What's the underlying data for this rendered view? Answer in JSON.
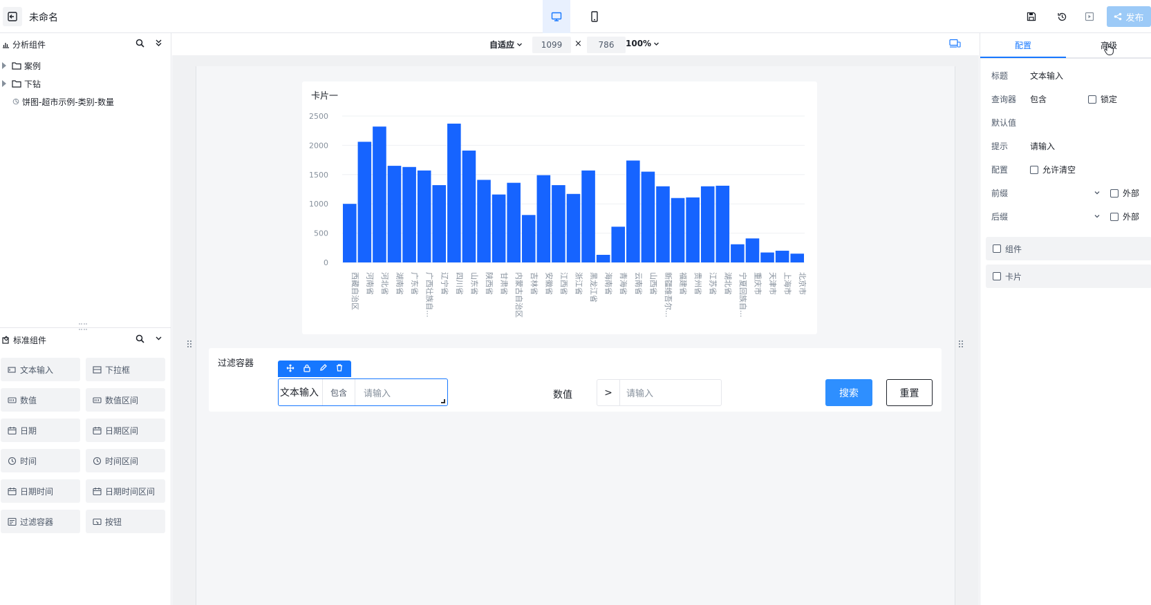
{
  "header": {
    "title": "未命名",
    "publish_label": "发布"
  },
  "left": {
    "analysis_title": "分析组件",
    "tree": [
      {
        "label": "案例",
        "type": "folder"
      },
      {
        "label": "下钻",
        "type": "folder"
      },
      {
        "label": "饼图-超市示例-类别-数量",
        "type": "chart"
      }
    ],
    "standard_title": "标准组件",
    "components": [
      {
        "label": "文本输入",
        "icon": "text-input-icon"
      },
      {
        "label": "下拉框",
        "icon": "select-icon"
      },
      {
        "label": "数值",
        "icon": "number-icon"
      },
      {
        "label": "数值区间",
        "icon": "number-range-icon"
      },
      {
        "label": "日期",
        "icon": "calendar-icon"
      },
      {
        "label": "日期区间",
        "icon": "calendar-icon"
      },
      {
        "label": "时间",
        "icon": "clock-icon"
      },
      {
        "label": "时间区间",
        "icon": "clock-icon"
      },
      {
        "label": "日期时间",
        "icon": "calendar-icon"
      },
      {
        "label": "日期时间区间",
        "icon": "calendar-icon"
      },
      {
        "label": "过滤容器",
        "icon": "filter-container-icon"
      },
      {
        "label": "按钮",
        "icon": "button-icon"
      }
    ]
  },
  "canvas": {
    "fit_label": "自适应",
    "width": "1099",
    "times": "×",
    "height": "786",
    "zoom": "100%"
  },
  "chart_card": {
    "title": "卡片一"
  },
  "chart_data": {
    "type": "bar",
    "categories": [
      "西藏自治区",
      "河南省",
      "河北省",
      "湖南省",
      "广东省",
      "广西壮族自...",
      "辽宁省",
      "四川省",
      "山东省",
      "陕西省",
      "甘肃省",
      "内蒙古自治区",
      "吉林省",
      "安徽省",
      "江西省",
      "浙江省",
      "黑龙江省",
      "海南省",
      "青海省",
      "云南省",
      "山西省",
      "新疆维吾尔...",
      "福建省",
      "贵州省",
      "江苏省",
      "湖北省",
      "宁夏回族自...",
      "重庆市",
      "天津市",
      "上海市",
      "北京市"
    ],
    "values": [
      1000,
      2060,
      2320,
      1650,
      1630,
      1570,
      1320,
      2370,
      1910,
      1410,
      1160,
      1360,
      810,
      1490,
      1320,
      1170,
      1570,
      130,
      610,
      1740,
      1550,
      1300,
      1100,
      1110,
      1300,
      1310,
      310,
      410,
      170,
      200,
      150
    ],
    "yticks": [
      "2500",
      "2000",
      "1500",
      "1000",
      "500",
      "0"
    ],
    "ylim": [
      0,
      2500
    ],
    "color": "#1664ff"
  },
  "filter": {
    "title": "过滤容器",
    "text_label": "文本输入",
    "text_op": "包含",
    "text_placeholder": "请输入",
    "num_label": "数值",
    "num_op": ">",
    "num_placeholder": "请输入",
    "search_label": "搜索",
    "reset_label": "重置"
  },
  "right": {
    "tab_config": "配置",
    "tab_advanced": "高级",
    "title_label": "标题",
    "title_value": "文本输入",
    "query_label": "查询器",
    "query_value": "包含",
    "lock_label": "锁定",
    "default_label": "默认值",
    "hint_label": "提示",
    "hint_value": "请输入",
    "config_label": "配置",
    "allow_clear_label": "允许清空",
    "prefix_label": "前缀",
    "prefix_external": "外部",
    "suffix_label": "后缀",
    "suffix_external": "外部",
    "group_component": "组件",
    "group_card": "卡片"
  }
}
